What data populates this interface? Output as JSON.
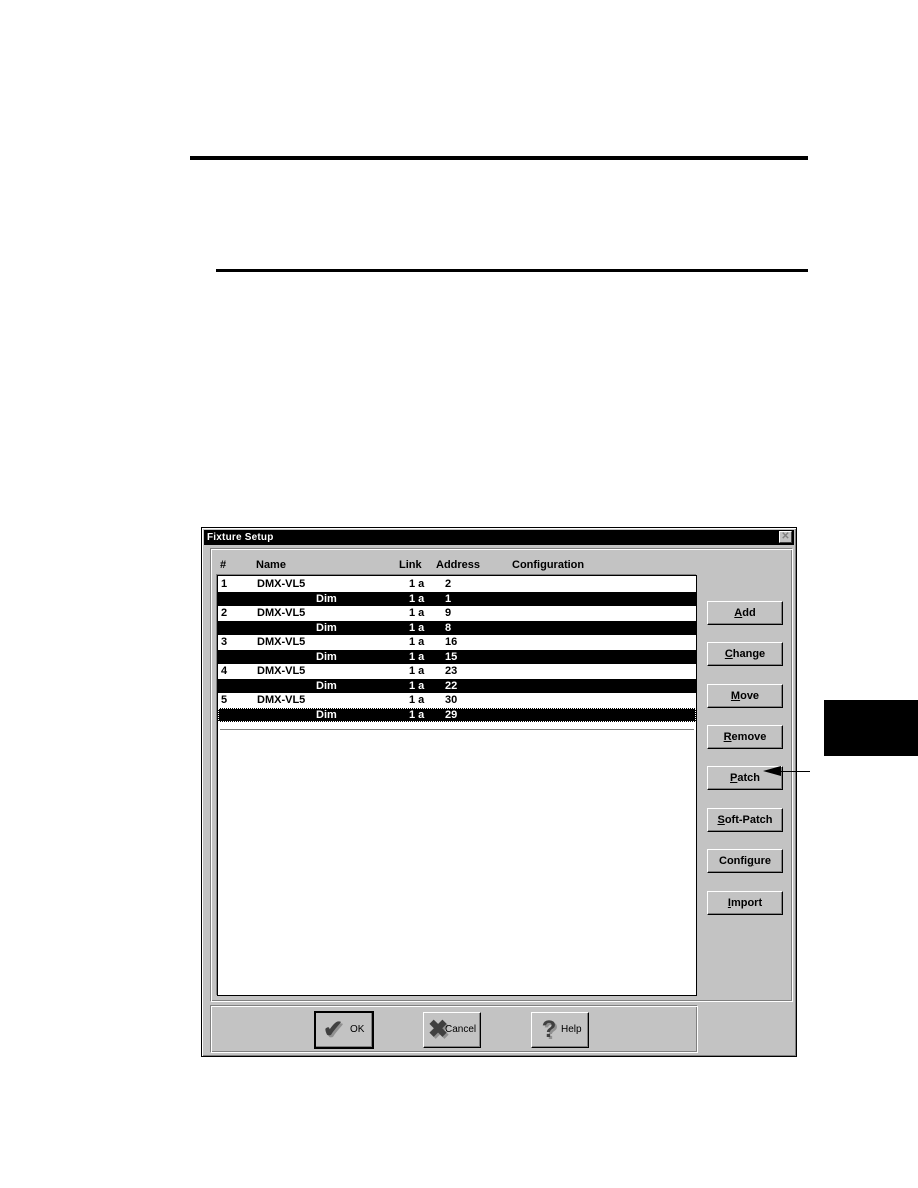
{
  "dialog": {
    "title": "Fixture Setup",
    "close_icon": "close-icon",
    "columns": [
      "#",
      "Name",
      "Link",
      "Address",
      "Configuration"
    ],
    "rows": [
      {
        "num": "1",
        "name": "DMX-VL5",
        "sub": "",
        "link": "1 a",
        "address": "2",
        "type": "fixture"
      },
      {
        "num": "",
        "name": "",
        "sub": "Dim",
        "link": "1 a",
        "address": "1",
        "type": "channel"
      },
      {
        "num": "2",
        "name": "DMX-VL5",
        "sub": "",
        "link": "1 a",
        "address": "9",
        "type": "fixture"
      },
      {
        "num": "",
        "name": "",
        "sub": "Dim",
        "link": "1 a",
        "address": "8",
        "type": "channel"
      },
      {
        "num": "3",
        "name": "DMX-VL5",
        "sub": "",
        "link": "1 a",
        "address": "16",
        "type": "fixture"
      },
      {
        "num": "",
        "name": "",
        "sub": "Dim",
        "link": "1 a",
        "address": "15",
        "type": "channel"
      },
      {
        "num": "4",
        "name": "DMX-VL5",
        "sub": "",
        "link": "1 a",
        "address": "23",
        "type": "fixture"
      },
      {
        "num": "",
        "name": "",
        "sub": "Dim",
        "link": "1 a",
        "address": "22",
        "type": "channel"
      },
      {
        "num": "5",
        "name": "DMX-VL5",
        "sub": "",
        "link": "1 a",
        "address": "30",
        "type": "fixture"
      },
      {
        "num": "",
        "name": "",
        "sub": "Dim",
        "link": "1 a",
        "address": "29",
        "type": "channel",
        "focused": true
      }
    ],
    "side_buttons": [
      {
        "id": "add",
        "pre": "",
        "mnemonic": "A",
        "post": "dd"
      },
      {
        "id": "change",
        "pre": "",
        "mnemonic": "C",
        "post": "hange"
      },
      {
        "id": "move",
        "pre": "",
        "mnemonic": "M",
        "post": "ove"
      },
      {
        "id": "remove",
        "pre": "",
        "mnemonic": "R",
        "post": "emove"
      },
      {
        "id": "patch",
        "pre": "",
        "mnemonic": "P",
        "post": "atch"
      },
      {
        "id": "soft-patch",
        "pre": "",
        "mnemonic": "S",
        "post": "oft-Patch"
      },
      {
        "id": "configure",
        "pre": "Confi",
        "mnemonic": "g",
        "post": "ure"
      },
      {
        "id": "import",
        "pre": "",
        "mnemonic": "I",
        "post": "mport"
      }
    ],
    "bottom_buttons": {
      "ok": {
        "label": "OK",
        "icon": "✔"
      },
      "cancel": {
        "label": "Cancel",
        "icon": "✖"
      },
      "help": {
        "label": "Help",
        "icon": "?"
      }
    }
  },
  "annotation": {
    "points_to": "Patch"
  }
}
